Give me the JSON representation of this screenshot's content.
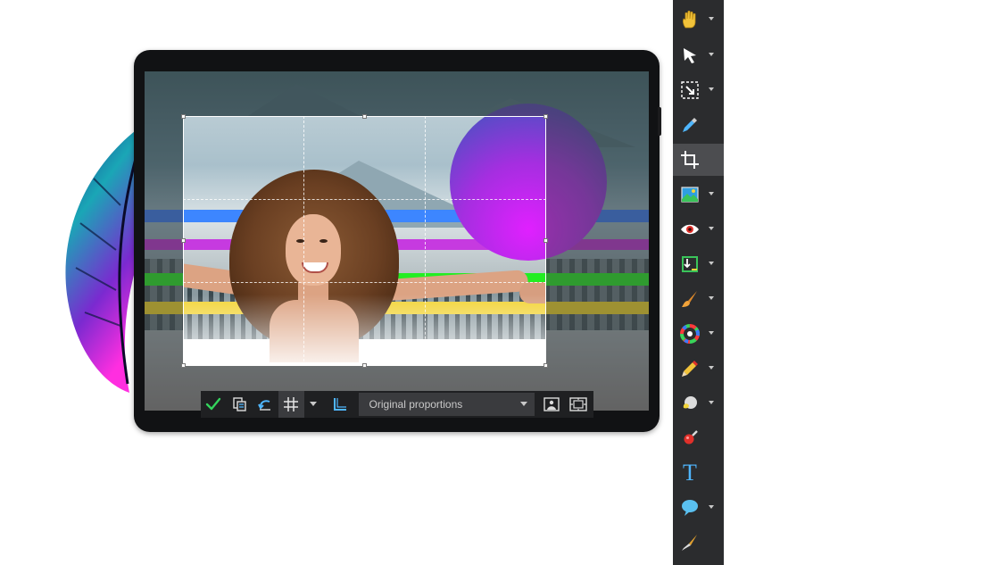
{
  "crop_toolbar": {
    "proportion_select": "Original proportions"
  },
  "tools_panel": {
    "items": [
      {
        "icon": "hand-icon",
        "has_dropdown": true,
        "active": false
      },
      {
        "icon": "select-arrow-icon",
        "has_dropdown": true,
        "active": false
      },
      {
        "icon": "selection-transform-icon",
        "has_dropdown": true,
        "active": false
      },
      {
        "icon": "eyedropper-icon",
        "has_dropdown": false,
        "active": false
      },
      {
        "icon": "crop-icon",
        "has_dropdown": false,
        "active": true
      },
      {
        "icon": "image-adjust-icon",
        "has_dropdown": true,
        "active": false
      },
      {
        "icon": "red-eye-icon",
        "has_dropdown": true,
        "active": false
      },
      {
        "icon": "straighten-icon",
        "has_dropdown": true,
        "active": false
      },
      {
        "icon": "brush-icon",
        "has_dropdown": true,
        "active": false
      },
      {
        "icon": "color-wheel-icon",
        "has_dropdown": true,
        "active": false
      },
      {
        "icon": "pencil-icon",
        "has_dropdown": true,
        "active": false
      },
      {
        "icon": "paint-bucket-icon",
        "has_dropdown": true,
        "active": false
      },
      {
        "icon": "clone-stamp-icon",
        "has_dropdown": false,
        "active": false
      },
      {
        "icon": "text-icon",
        "has_dropdown": false,
        "active": false
      },
      {
        "icon": "speech-bubble-icon",
        "has_dropdown": true,
        "active": false
      },
      {
        "icon": "vector-pen-icon",
        "has_dropdown": false,
        "active": false
      }
    ],
    "text_tool_glyph": "T"
  },
  "colors": {
    "panel_bg": "#2b2c2e",
    "toolbar_bg": "#1f2022",
    "accent_check": "#33d45c",
    "tool_icon_blue": "#4fb6ff"
  }
}
